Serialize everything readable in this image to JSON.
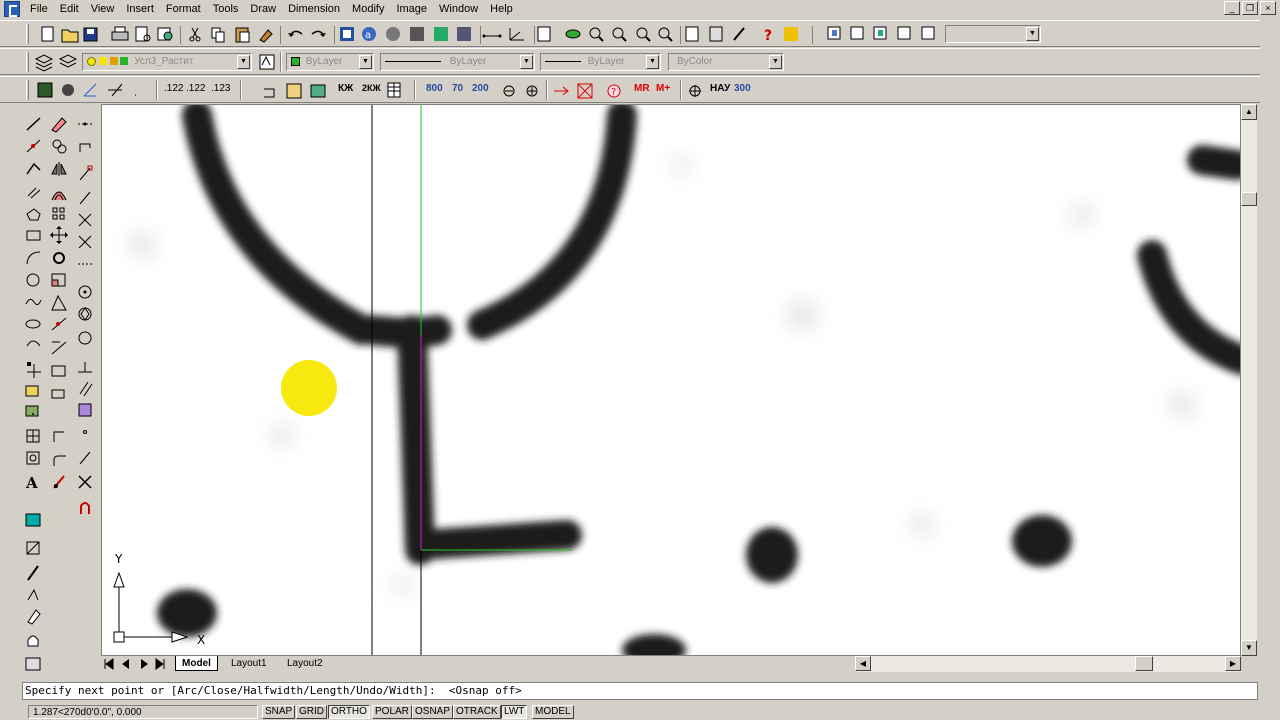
{
  "menu": [
    "File",
    "Edit",
    "View",
    "Insert",
    "Format",
    "Tools",
    "Draw",
    "Dimension",
    "Modify",
    "Image",
    "Window",
    "Help"
  ],
  "layer_combo": "Усл3_Растит",
  "color_combo": "ByLayer",
  "linetype_combo": "ByLayer",
  "lineweight_combo": "ByLayer",
  "plotstyle_combo": "ByColor",
  "dim_buttons": [
    ".122",
    ".122",
    ".123"
  ],
  "text_buttons": [
    "КЖ",
    "2КЖ"
  ],
  "num_buttons": [
    "800",
    "70",
    "200"
  ],
  "m_buttons": [
    "МR",
    "М+"
  ],
  "nau_label": "НАУ",
  "num300": "300",
  "tabs": [
    "Model",
    "Layout1",
    "Layout2"
  ],
  "ucs": {
    "x": "X",
    "y": "Y"
  },
  "command_line": "Specify next point or [Arc/Close/Halfwidth/Length/Undo/Width]:  <Osnap off>",
  "coordinates": "1.287<270d0'0.0\", 0.000",
  "status_buttons": [
    {
      "label": "SNAP",
      "on": false
    },
    {
      "label": "GRID",
      "on": false
    },
    {
      "label": "ORTHO",
      "on": true
    },
    {
      "label": "POLAR",
      "on": false
    },
    {
      "label": "OSNAP",
      "on": false
    },
    {
      "label": "OTRACK",
      "on": false
    },
    {
      "label": "LWT",
      "on": true
    },
    {
      "label": "MODEL",
      "on": false
    }
  ],
  "colors": {
    "accent": "#3a66c4",
    "cursor_highlight": "#f5e800",
    "crosshair_green": "#28c828",
    "crosshair_magenta": "#d020d0"
  }
}
